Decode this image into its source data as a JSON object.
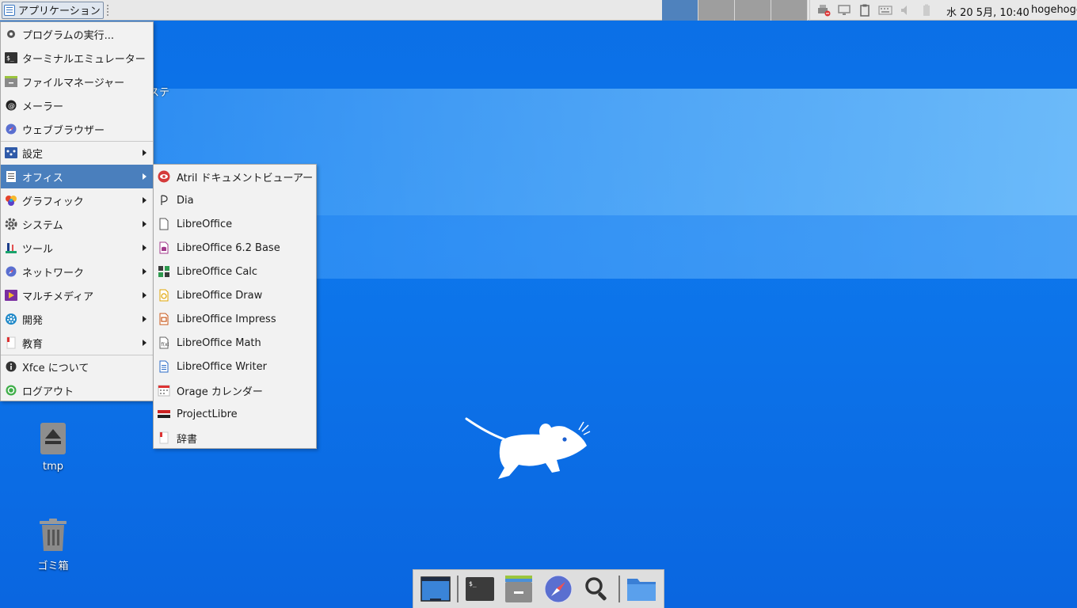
{
  "top_panel": {
    "app_menu_label": "アプリケーション",
    "clock": "水 20 5月, 10:40",
    "user": "hogehoge",
    "workspaces": 4
  },
  "main_menu": {
    "items": [
      {
        "label": "プログラムの実行...",
        "icon": "gear-run-icon"
      },
      {
        "label": "ターミナルエミュレーター",
        "icon": "terminal-icon"
      },
      {
        "label": "ファイルマネージャー",
        "icon": "file-manager-icon"
      },
      {
        "label": "メーラー",
        "icon": "mail-icon"
      },
      {
        "label": "ウェブブラウザー",
        "icon": "web-browser-icon"
      },
      {
        "label": "設定",
        "icon": "settings-icon",
        "submenu": true
      },
      {
        "label": "オフィス",
        "icon": "office-icon",
        "submenu": true,
        "active": true
      },
      {
        "label": "グラフィック",
        "icon": "graphics-icon",
        "submenu": true
      },
      {
        "label": "システム",
        "icon": "system-gear-icon",
        "submenu": true
      },
      {
        "label": "ツール",
        "icon": "tools-icon",
        "submenu": true
      },
      {
        "label": "ネットワーク",
        "icon": "network-icon",
        "submenu": true
      },
      {
        "label": "マルチメディア",
        "icon": "multimedia-icon",
        "submenu": true
      },
      {
        "label": "開発",
        "icon": "development-icon",
        "submenu": true
      },
      {
        "label": "教育",
        "icon": "education-icon",
        "submenu": true
      },
      {
        "label": "Xfce について",
        "icon": "info-icon"
      },
      {
        "label": "ログアウト",
        "icon": "logout-icon"
      }
    ]
  },
  "office_submenu": {
    "items": [
      {
        "label": "Atril ドキュメントビューアー",
        "icon": "atril-icon"
      },
      {
        "label": "Dia",
        "icon": "dia-icon"
      },
      {
        "label": "LibreOffice",
        "icon": "libreoffice-icon"
      },
      {
        "label": "LibreOffice 6.2 Base",
        "icon": "libreoffice-base-icon"
      },
      {
        "label": "LibreOffice Calc",
        "icon": "libreoffice-calc-icon"
      },
      {
        "label": "LibreOffice Draw",
        "icon": "libreoffice-draw-icon"
      },
      {
        "label": "LibreOffice Impress",
        "icon": "libreoffice-impress-icon"
      },
      {
        "label": "LibreOffice Math",
        "icon": "libreoffice-math-icon"
      },
      {
        "label": "LibreOffice Writer",
        "icon": "libreoffice-writer-icon"
      },
      {
        "label": "Orage カレンダー",
        "icon": "calendar-icon"
      },
      {
        "label": "ProjectLibre",
        "icon": "projectlibre-icon"
      },
      {
        "label": "辞書",
        "icon": "dictionary-icon"
      }
    ]
  },
  "desktop": {
    "partial_label": "ステ",
    "icons": [
      {
        "label": "tmp",
        "icon": "eject-drive-icon"
      },
      {
        "label": "ゴミ箱",
        "icon": "trash-icon"
      }
    ]
  },
  "dock": {
    "items": [
      "show-desktop-icon",
      "terminal-icon",
      "file-manager-icon",
      "web-browser-icon",
      "search-icon",
      "folder-icon"
    ]
  },
  "colors": {
    "accent": "#4a7fbd",
    "desktop": "#0b6fe6",
    "panel": "#e8e8e8"
  }
}
